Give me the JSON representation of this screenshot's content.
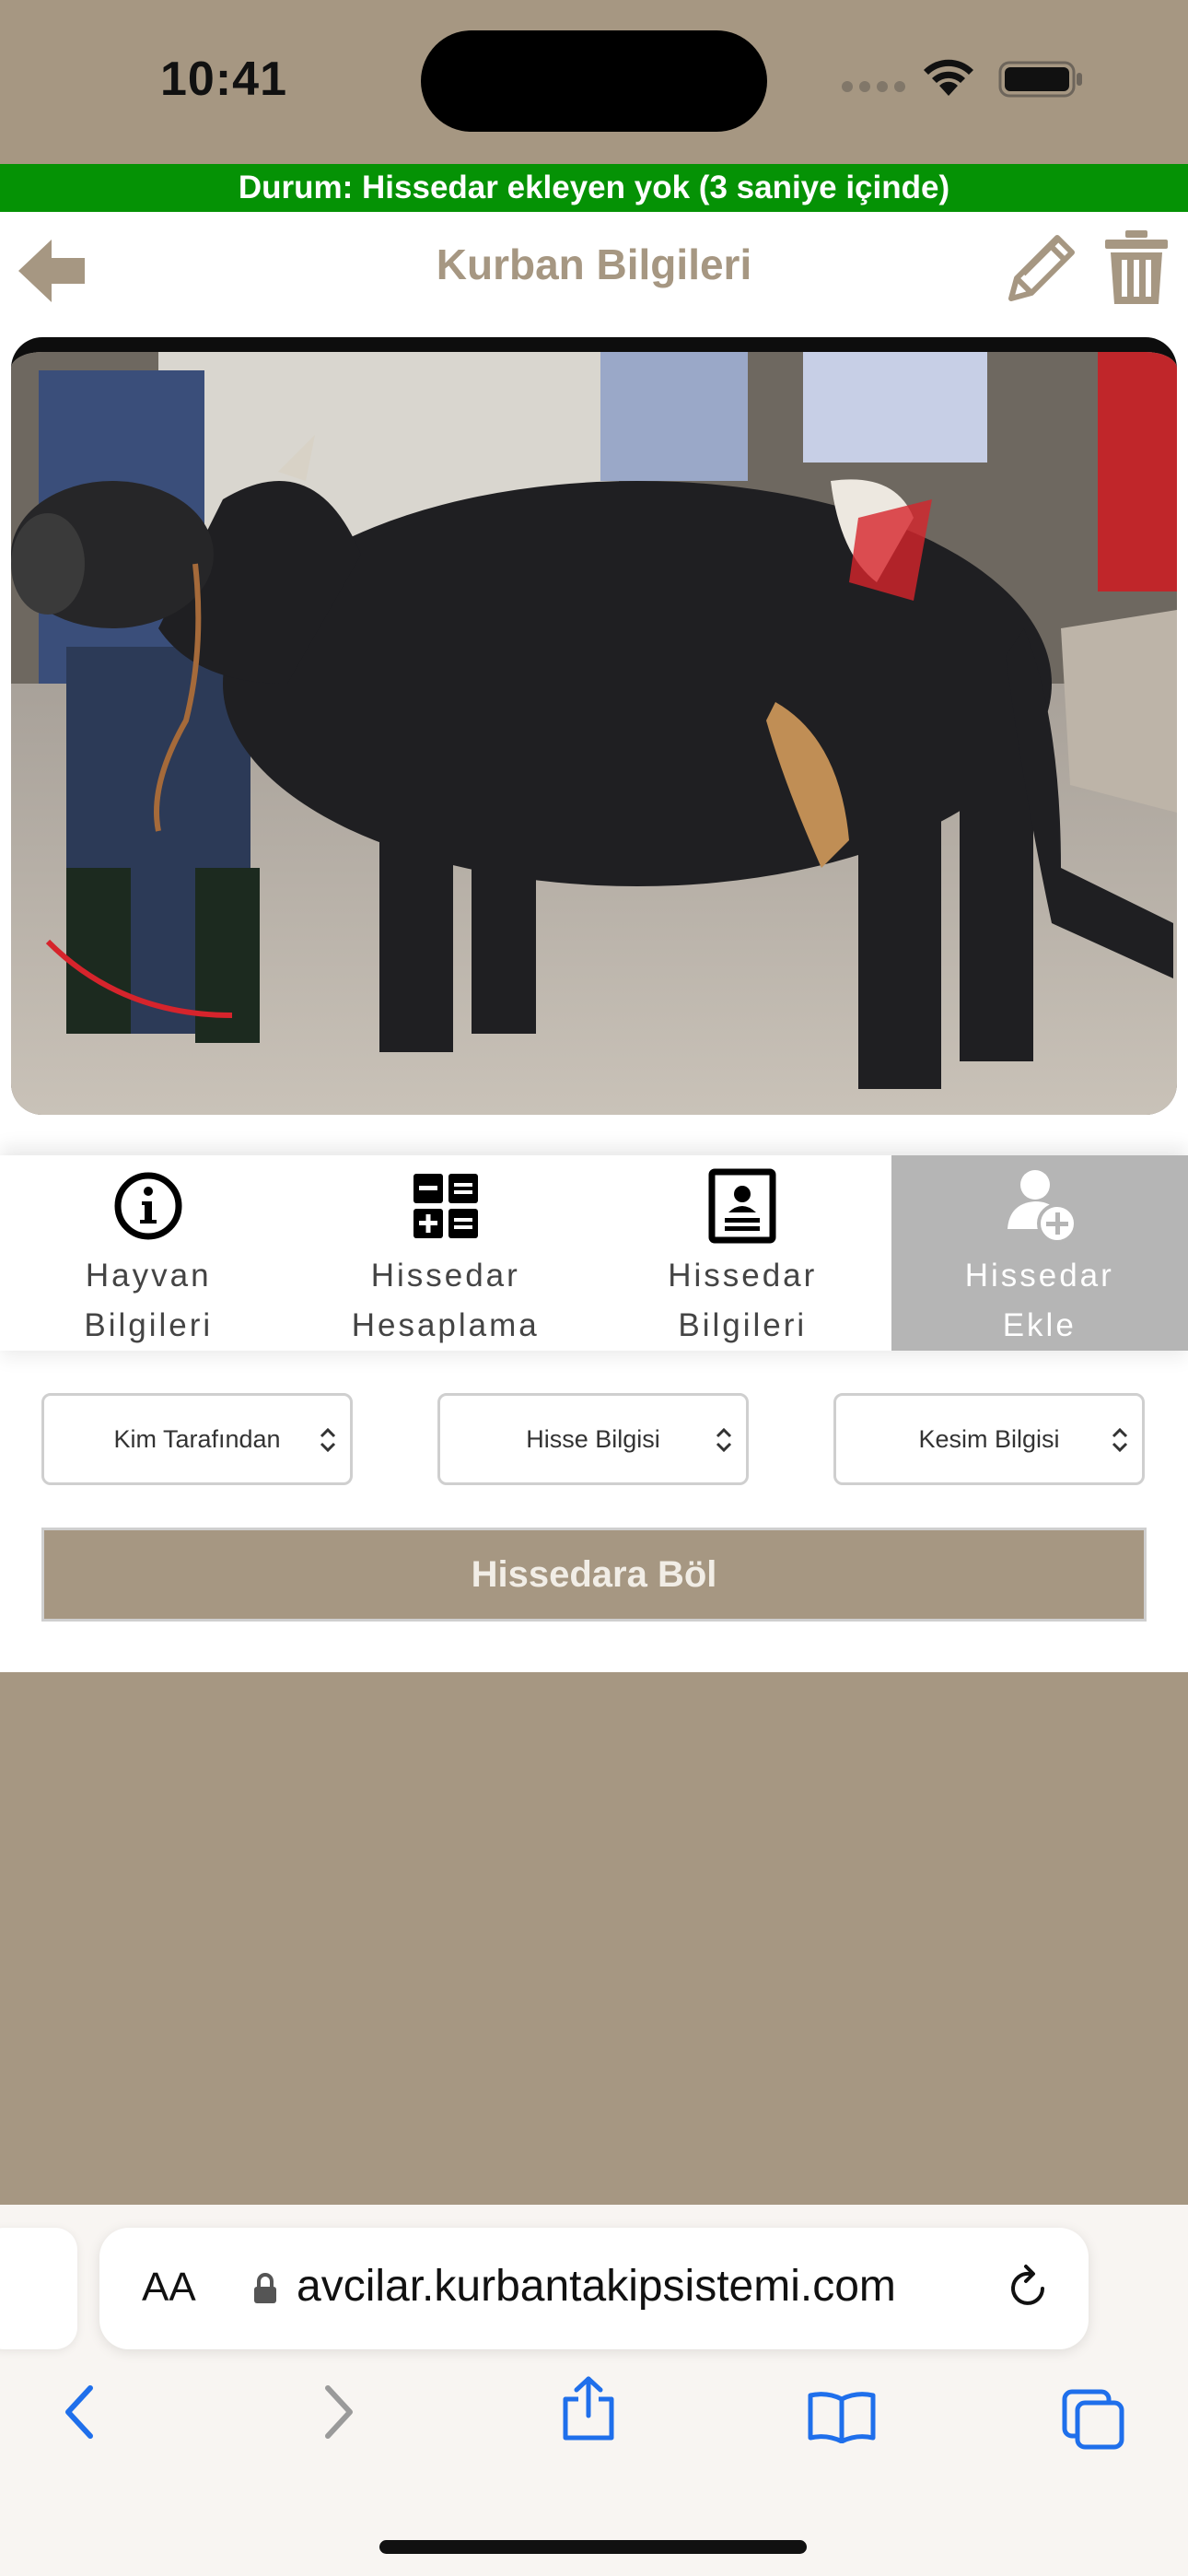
{
  "status_bar": {
    "time": "10:41"
  },
  "banner": {
    "text": "Durum: Hissedar ekleyen yok (3 saniye içinde)"
  },
  "header": {
    "title": "Kurban Bilgileri"
  },
  "tabs": [
    {
      "label": "Hayvan\nBilgileri",
      "icon": "info-icon",
      "active": false
    },
    {
      "label": "Hissedar\nHesaplama",
      "icon": "calculator-icon",
      "active": false
    },
    {
      "label": "Hissedar\nBilgileri",
      "icon": "contact-card-icon",
      "active": false
    },
    {
      "label": "Hissedar\nEkle",
      "icon": "add-user-icon",
      "active": true
    }
  ],
  "selects": {
    "by_whom": "Kim Tarafından",
    "share_info": "Hisse Bilgisi",
    "cut_info": "Kesim Bilgisi"
  },
  "actions": {
    "split_label": "Hissedara Böl"
  },
  "browser": {
    "text_size_label": "AA",
    "url": "avcilar.kurbantakipsistemi.com"
  },
  "colors": {
    "brand_tan": "#a69782",
    "banner_green": "#059205",
    "active_tab_gray": "#b5b5b5",
    "safari_blue": "#1f6feb"
  }
}
